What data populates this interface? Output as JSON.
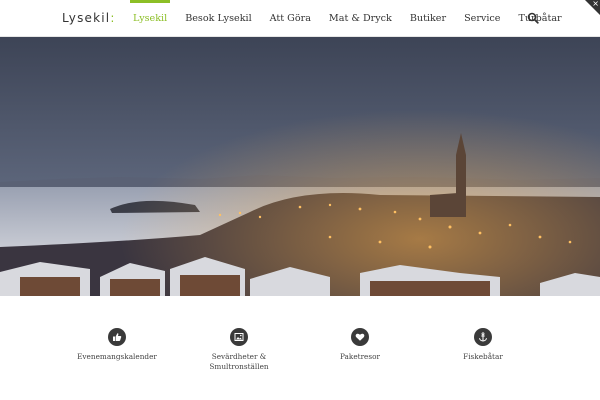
{
  "header": {
    "logo_main": "Lysekil",
    "logo_accent": ":",
    "nav": [
      {
        "label": "Lysekil",
        "active": true
      },
      {
        "label": "Besok Lysekil",
        "active": false
      },
      {
        "label": "Att Göra",
        "active": false
      },
      {
        "label": "Mat & Dryck",
        "active": false
      },
      {
        "label": "Butiker",
        "active": false
      },
      {
        "label": "Service",
        "active": false
      },
      {
        "label": "Turbåtar",
        "active": false
      }
    ],
    "search_icon": "search-icon",
    "corner_icon": "close-icon"
  },
  "hero": {
    "image": "night-town-harbor-with-church"
  },
  "features": [
    {
      "icon": "thumbs-up-icon",
      "label": "Evenemangskalender"
    },
    {
      "icon": "image-icon",
      "label_line1": "Sevärdheter &",
      "label_line2": "Smultronställen"
    },
    {
      "icon": "heart-icon",
      "label": "Paketresor"
    },
    {
      "icon": "anchor-icon",
      "label": "Fiskebåtar"
    }
  ],
  "colors": {
    "accent": "#8cbf26",
    "text": "#333333",
    "icon_bg": "#3a3a3a"
  }
}
